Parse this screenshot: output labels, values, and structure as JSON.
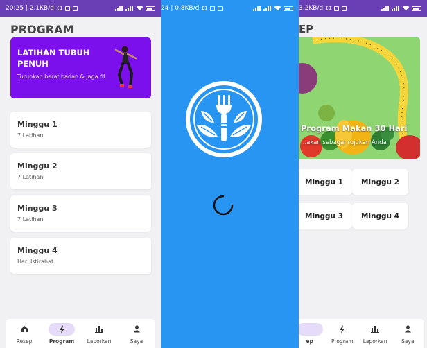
{
  "screen_program": {
    "status": {
      "time_data": "20:25 | 2,1KB/d"
    },
    "title": "PROGRAM",
    "banner": {
      "title": "LATIHAN TUBUH PENUH",
      "subtitle": "Turunkan berat badan & jaga fit",
      "color": "#7c10ec"
    },
    "weeks": [
      {
        "title": "Minggu 1",
        "subtitle": "7 Latihan"
      },
      {
        "title": "Minggu 2",
        "subtitle": "7 Latihan"
      },
      {
        "title": "Minggu 3",
        "subtitle": "7 Latihan"
      },
      {
        "title": "Minggu 4",
        "subtitle": "Hari Istirahat"
      }
    ],
    "nav": [
      {
        "label": "Resep",
        "icon": "home-icon"
      },
      {
        "label": "Program",
        "icon": "bolt-icon",
        "active": true
      },
      {
        "label": "Laporkan",
        "icon": "bar-chart-icon"
      },
      {
        "label": "Saya",
        "icon": "person-icon"
      }
    ]
  },
  "screen_splash": {
    "status": {
      "time_data": "24 | 0,8KB/d"
    },
    "background": "#2895f2",
    "logo_icon": "fork-leaves-logo-icon",
    "loader_icon": "loading-spinner-icon"
  },
  "screen_recipe": {
    "status": {
      "time_data": "3,2KB/d"
    },
    "title": "EP",
    "banner": {
      "title": "Program Makan 30 Hari",
      "subtitle": "...akan sebagai rujukan Anda"
    },
    "weeks": [
      "Minggu 1",
      "Minggu 2",
      "Minggu 3",
      "Minggu 4"
    ],
    "nav": [
      {
        "label": "ep",
        "icon": "home-icon",
        "active": true
      },
      {
        "label": "Program",
        "icon": "bolt-icon"
      },
      {
        "label": "Laporkan",
        "icon": "bar-chart-icon"
      },
      {
        "label": "Saya",
        "icon": "person-icon"
      }
    ]
  },
  "colors": {
    "status_bar": "#6a3fb6",
    "accent": "#7c10ec",
    "nav_active_pill": "#e6dbf8"
  }
}
